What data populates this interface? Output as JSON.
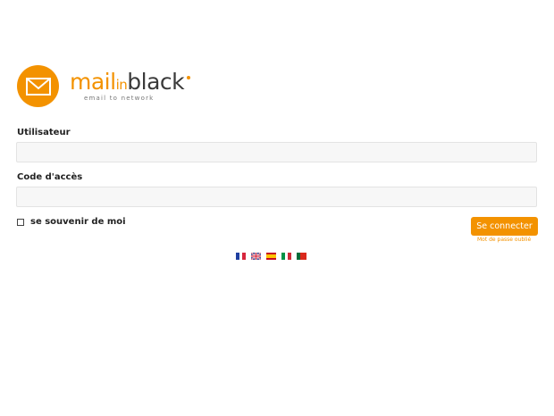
{
  "brand": {
    "word_mail": "mail",
    "word_in": "in",
    "word_black": "black",
    "tagline": "email to network",
    "icon": "envelope-icon",
    "accent_color": "#f39200"
  },
  "form": {
    "username_label": "Utilisateur",
    "username_value": "",
    "password_label": "Code d'accès",
    "password_value": "",
    "remember_label": "se souvenir de moi",
    "remember_checked": false,
    "login_button": "Se connecter",
    "forgot_link": "Mot de passe oublié"
  },
  "languages": [
    {
      "code": "fr",
      "icon": "flag-france-icon"
    },
    {
      "code": "en",
      "icon": "flag-uk-icon"
    },
    {
      "code": "es",
      "icon": "flag-spain-icon"
    },
    {
      "code": "it",
      "icon": "flag-italy-icon"
    },
    {
      "code": "pt",
      "icon": "flag-portugal-icon"
    }
  ]
}
